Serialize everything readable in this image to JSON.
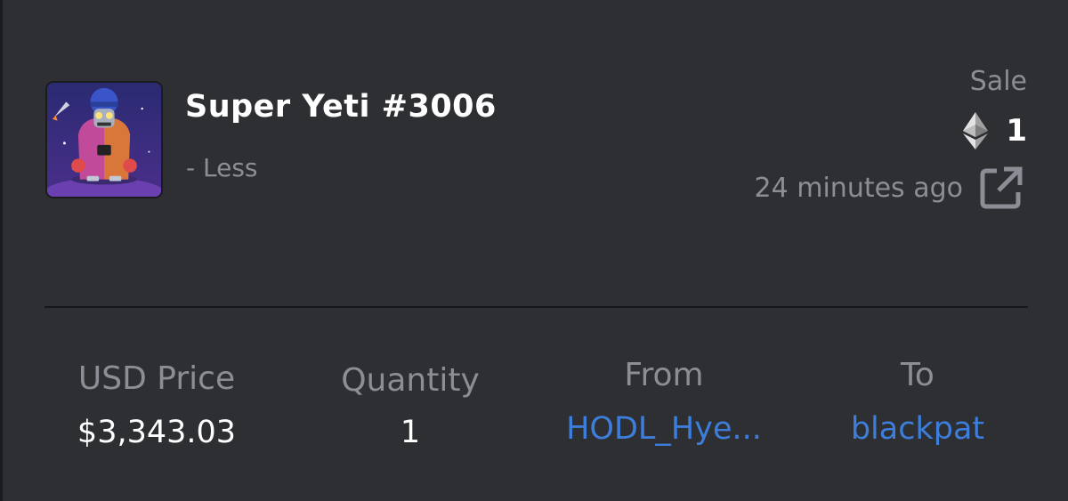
{
  "item": {
    "title": "Super Yeti #3006",
    "toggle_label": "- Less",
    "image_icon": "yeti-nft-image"
  },
  "event": {
    "type_label": "Sale",
    "currency_icon": "ethereum-icon",
    "amount": "1",
    "time_ago": "24 minutes ago",
    "link_icon": "external-link-icon"
  },
  "details": {
    "usd_price": {
      "label": "USD Price",
      "value": "$3,343.03"
    },
    "quantity": {
      "label": "Quantity",
      "value": "1"
    },
    "from": {
      "label": "From",
      "value": "HODL_Hye..."
    },
    "to": {
      "label": "To",
      "value": "blackpat"
    }
  },
  "colors": {
    "background": "#2d2f33",
    "muted_text": "#8b8e94",
    "link": "#3d7edb",
    "divider": "#16171a"
  }
}
